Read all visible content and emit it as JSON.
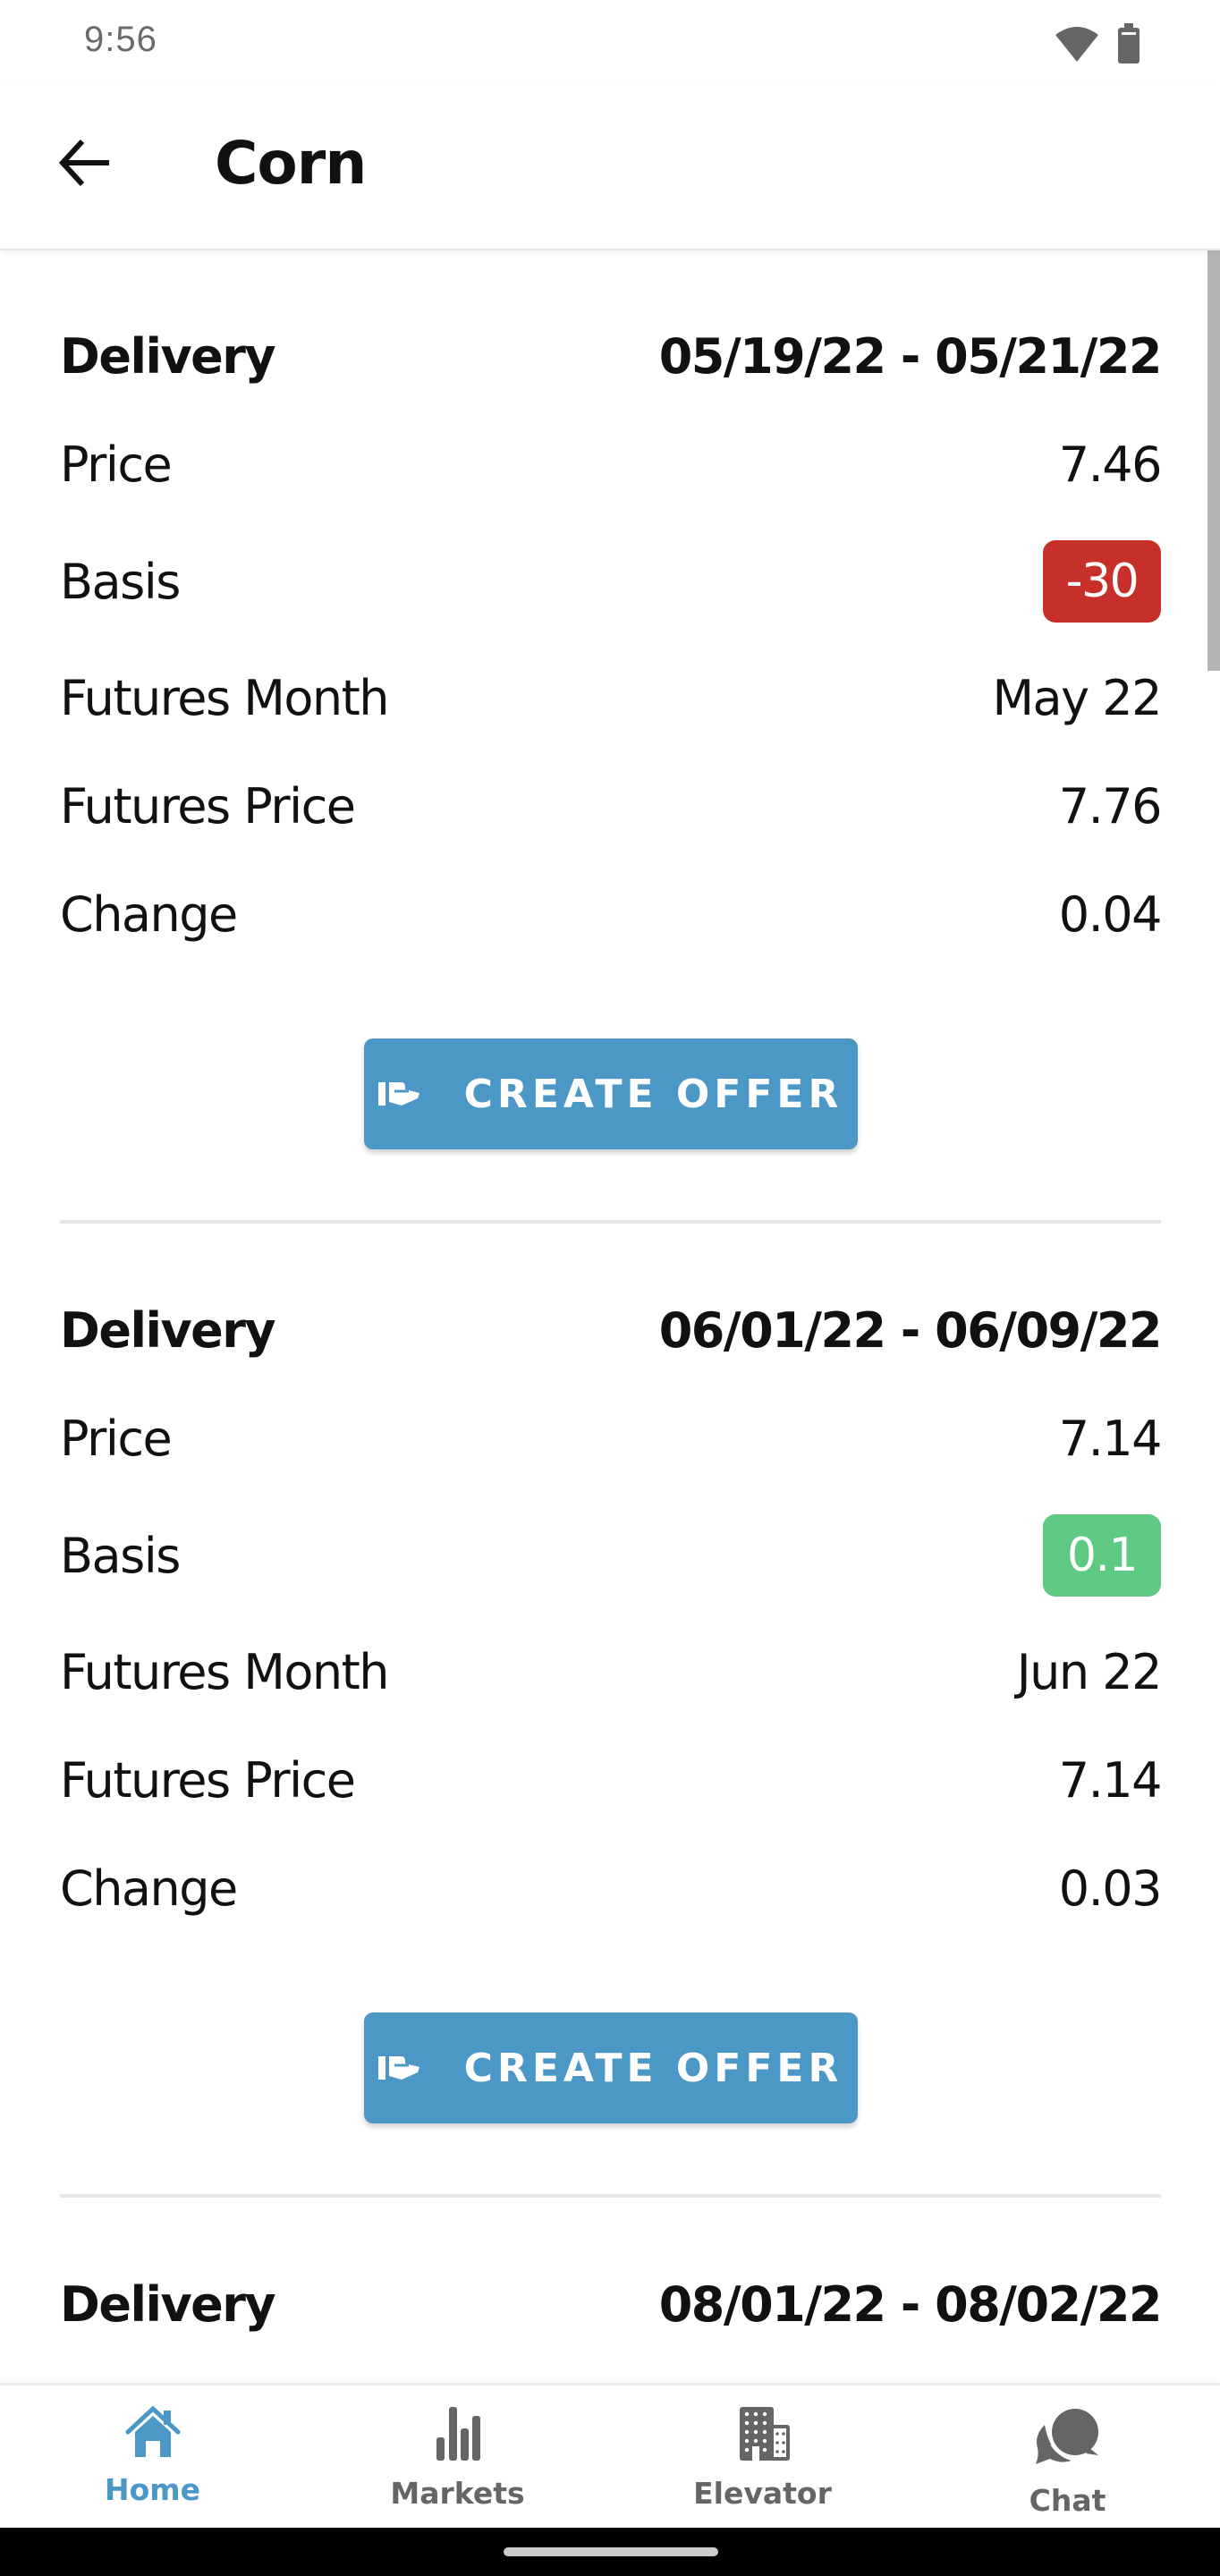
{
  "status_bar": {
    "time": "9:56",
    "icons": [
      "wifi-icon",
      "battery-icon"
    ]
  },
  "app_bar": {
    "back_icon": "arrow-left-icon",
    "title": "Corn"
  },
  "colors": {
    "accent": "#4b97c6",
    "basis_negative": "#c62f2a",
    "basis_positive": "#5dc983",
    "nav_inactive": "#656565"
  },
  "cards": [
    {
      "delivery_label": "Delivery",
      "delivery_value": "05/19/22 - 05/21/22",
      "price_label": "Price",
      "price_value": "7.46",
      "basis_label": "Basis",
      "basis_value": "-30",
      "basis_sign": "negative",
      "futures_month_label": "Futures Month",
      "futures_month_value": "May 22",
      "futures_price_label": "Futures Price",
      "futures_price_value": "7.76",
      "change_label": "Change",
      "change_value": "0.04",
      "button_label": "CREATE OFFER",
      "button_icon": "hand-offer-icon"
    },
    {
      "delivery_label": "Delivery",
      "delivery_value": "06/01/22 - 06/09/22",
      "price_label": "Price",
      "price_value": "7.14",
      "basis_label": "Basis",
      "basis_value": "0.1",
      "basis_sign": "positive",
      "futures_month_label": "Futures Month",
      "futures_month_value": "Jun 22",
      "futures_price_label": "Futures Price",
      "futures_price_value": "7.14",
      "change_label": "Change",
      "change_value": "0.03",
      "button_label": "CREATE OFFER",
      "button_icon": "hand-offer-icon"
    },
    {
      "delivery_label": "Delivery",
      "delivery_value": "08/01/22 - 08/02/22"
    }
  ],
  "bottom_nav": {
    "items": [
      {
        "label": "Home",
        "icon": "home-icon",
        "active": true
      },
      {
        "label": "Markets",
        "icon": "bar-chart-icon",
        "active": false
      },
      {
        "label": "Elevator",
        "icon": "building-icon",
        "active": false
      },
      {
        "label": "Chat",
        "icon": "chat-bubbles-icon",
        "active": false
      }
    ]
  }
}
